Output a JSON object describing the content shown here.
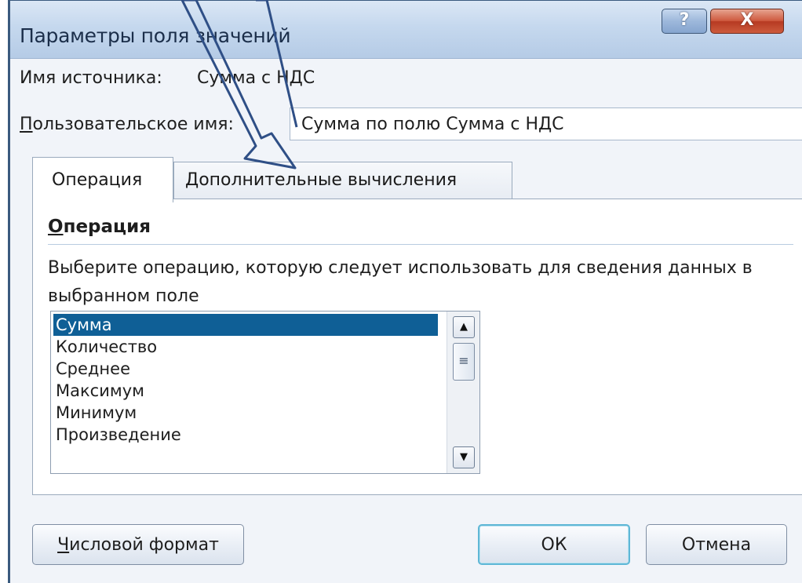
{
  "window": {
    "title": "Параметры поля значений",
    "help_label": "?",
    "close_label": "X"
  },
  "source": {
    "label": "Имя источника:",
    "value": "Сумма с НДС"
  },
  "custom_name": {
    "label_accel": "П",
    "label_rest": "ользовательское имя:",
    "value": "Сумма по полю Сумма с НДС"
  },
  "tabs": [
    {
      "label": "Операция",
      "active": true
    },
    {
      "label": "Дополнительные вычисления",
      "active": false
    }
  ],
  "panel": {
    "title_accel": "О",
    "title_rest": "перация",
    "description": "Выберите операцию, которую следует использовать для сведения данных в выбранном поле"
  },
  "operations": {
    "items": [
      "Сумма",
      "Количество",
      "Среднее",
      "Максимум",
      "Минимум",
      "Произведение"
    ],
    "selected": "Сумма"
  },
  "scrollbar": {
    "up_icon": "▲",
    "down_icon": "▼",
    "thumb_icon": "≡"
  },
  "buttons": {
    "number_format_accel": "Ч",
    "number_format_rest": "исловой формат",
    "ok": "ОК",
    "cancel": "Отмена"
  },
  "overlay": {
    "arrow_color": "#2f4f86"
  }
}
